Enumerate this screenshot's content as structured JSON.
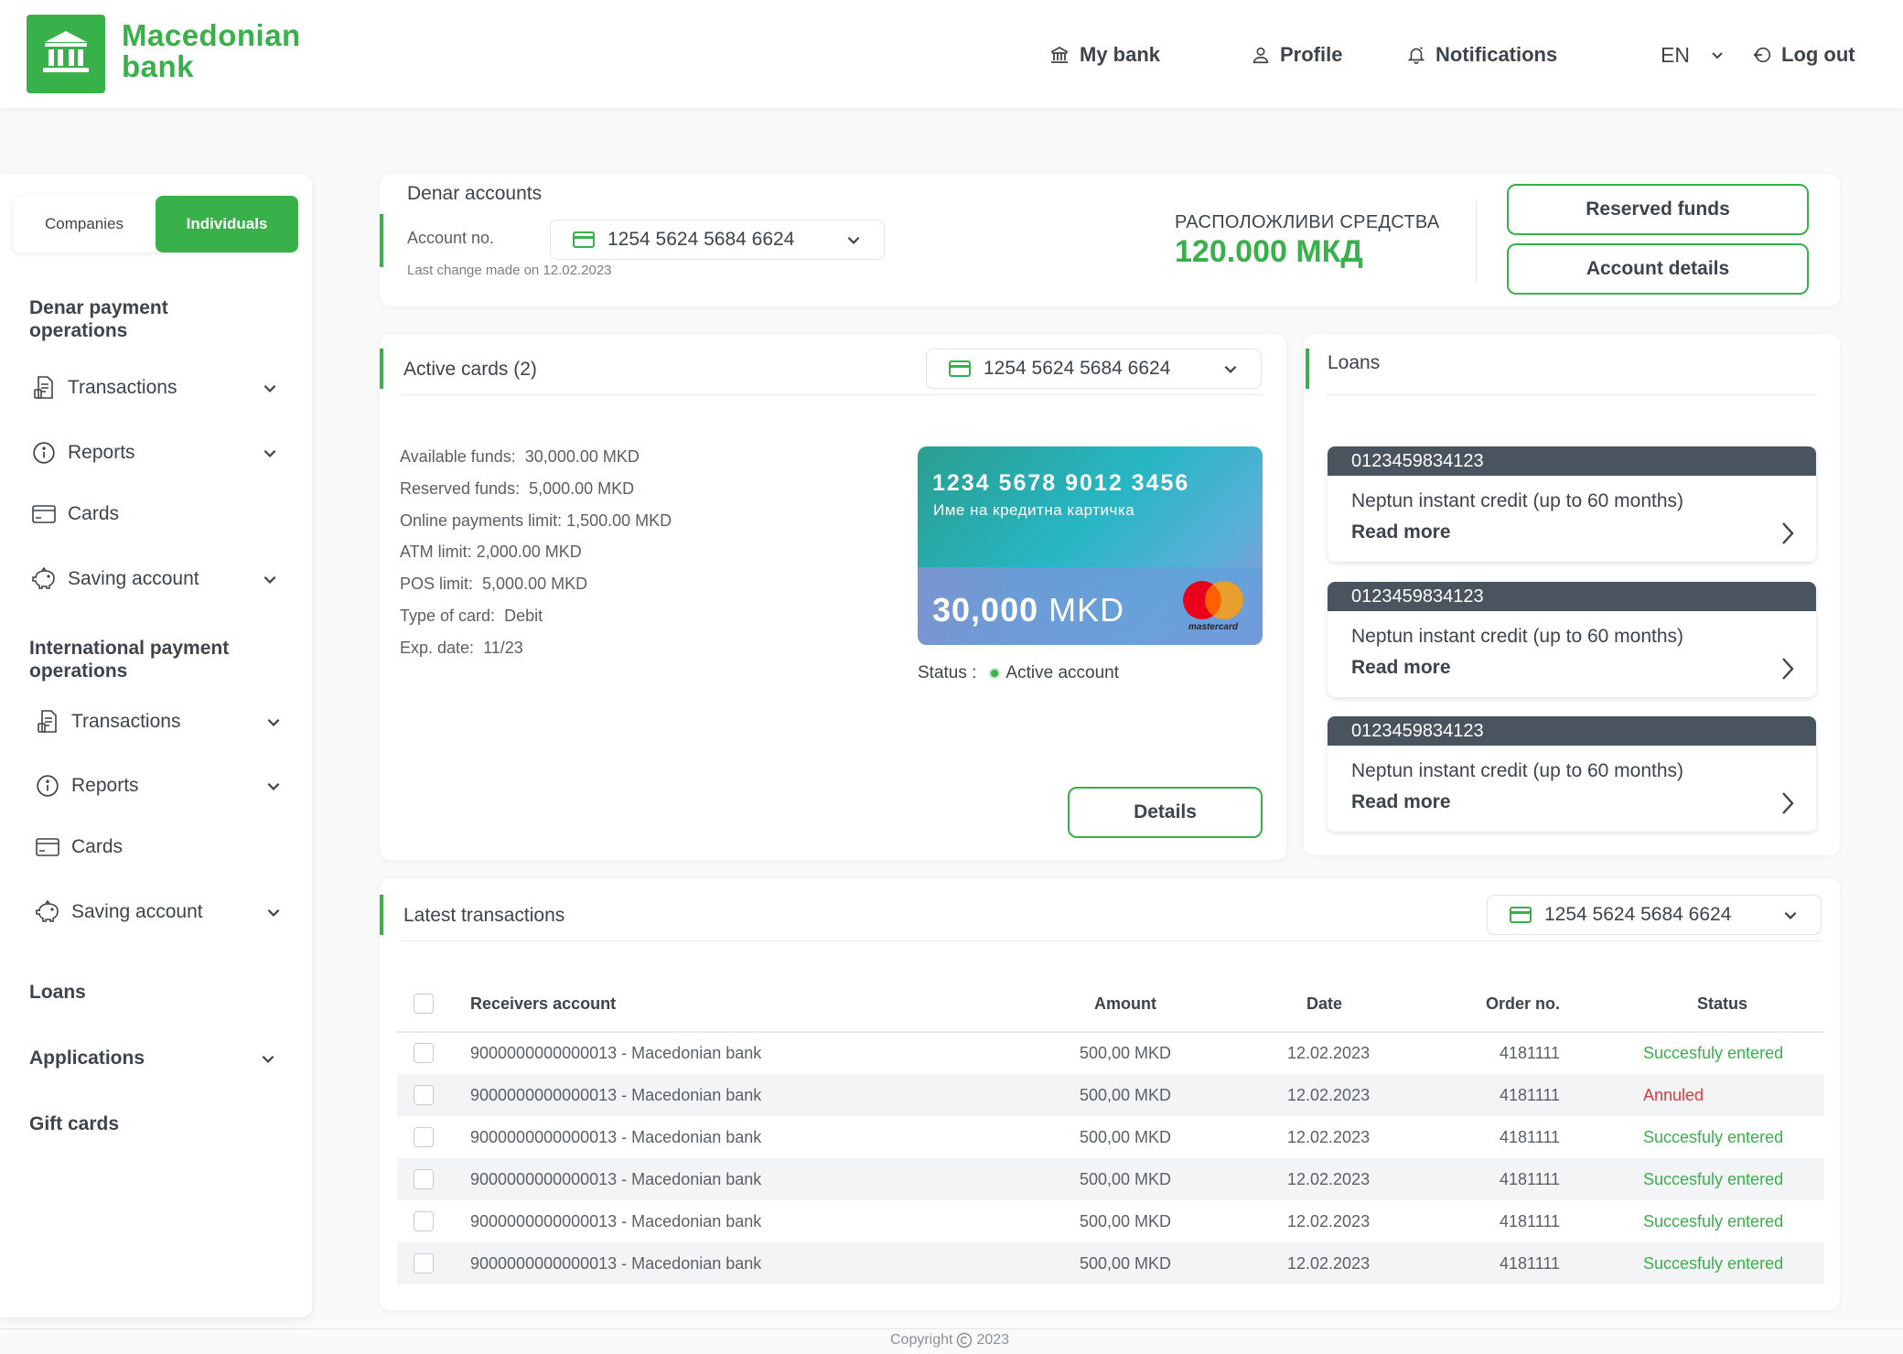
{
  "brand": {
    "line1": "Macedonian",
    "line2": "bank",
    "color": "#38b14a"
  },
  "nav": {
    "my_bank": "My bank",
    "profile": "Profile",
    "notifications": "Notifications",
    "language": "EN",
    "logout": "Log out"
  },
  "sidebar": {
    "tabs": {
      "companies": "Companies",
      "individuals": "Individuals",
      "active": "Individuals"
    },
    "denar_section": "Denar payment operations",
    "denar_items": [
      {
        "label": "Transactions",
        "icon": "document-icon"
      },
      {
        "label": "Reports",
        "icon": "info-icon"
      },
      {
        "label": "Cards",
        "icon": "card-icon"
      },
      {
        "label": "Saving account",
        "icon": "piggy-bank-icon"
      }
    ],
    "intl_section": "International payment operations",
    "intl_items": [
      {
        "label": "Transactions",
        "icon": "document-icon"
      },
      {
        "label": "Reports",
        "icon": "info-icon"
      },
      {
        "label": "Cards",
        "icon": "card-icon"
      },
      {
        "label": "Saving account",
        "icon": "piggy-bank-icon"
      }
    ],
    "loans": "Loans",
    "applications": "Applications",
    "gift_cards": "Gift cards"
  },
  "denar_accounts": {
    "title": "Denar accounts",
    "account_label": "Account no.",
    "account_number": "1254 5624 5684 6624",
    "last_change": "Last change made on 12.02.2023",
    "available_label": "РАСПОЛОЖЛИВИ СРЕДСТВА",
    "available_amount": "120.000 МКД",
    "reserved_button": "Reserved funds",
    "details_button": "Account details"
  },
  "active_cards": {
    "title": "Active cards (2)",
    "selected_account": "1254 5624 5684 6624",
    "info": [
      {
        "label": "Available funds:",
        "value": "30,000.00 MKD"
      },
      {
        "label": "Reserved funds:",
        "value": "5,000.00 MKD"
      },
      {
        "label": "Online payments limit:",
        "value": "1,500.00 MKD"
      },
      {
        "label": "ATM limit:",
        "value": "2,000.00 MKD"
      },
      {
        "label": "POS limit:",
        "value": "5,000.00 MKD"
      },
      {
        "label": "Type of card:",
        "value": "Debit"
      },
      {
        "label": "Exp. date:",
        "value": "11/23"
      }
    ],
    "card": {
      "number": "1234 5678 9012 3456",
      "name": "Име на кредитна картичка",
      "balance_value": "30,000",
      "balance_currency": "MKD",
      "brand": "mastercard"
    },
    "status_label": "Status :",
    "status_value": "Active account",
    "details_button": "Details"
  },
  "loans": {
    "title": "Loans",
    "items": [
      {
        "number": "0123459834123",
        "name": "Neptun instant credit (up to 60 months)",
        "link": "Read more"
      },
      {
        "number": "0123459834123",
        "name": "Neptun instant credit (up to 60 months)",
        "link": "Read more"
      },
      {
        "number": "0123459834123",
        "name": "Neptun instant credit (up to 60 months)",
        "link": "Read more"
      }
    ]
  },
  "transactions": {
    "title": "Latest transactions",
    "selected_account": "1254 5624 5684 6624",
    "columns": [
      "Receivers account",
      "Amount",
      "Date",
      "Order no.",
      "Status"
    ],
    "rows": [
      {
        "account": "9000000000000013 - Macedonian bank",
        "amount": "500,00 MKD",
        "date": "12.02.2023",
        "order": "4181111",
        "status": "Succesfuly entered",
        "status_color": "#38b14a"
      },
      {
        "account": "9000000000000013 - Macedonian bank",
        "amount": "500,00 MKD",
        "date": "12.02.2023",
        "order": "4181111",
        "status": "Annuled",
        "status_color": "#e03a3a"
      },
      {
        "account": "9000000000000013 - Macedonian bank",
        "amount": "500,00 MKD",
        "date": "12.02.2023",
        "order": "4181111",
        "status": "Succesfuly entered",
        "status_color": "#38b14a"
      },
      {
        "account": "9000000000000013 - Macedonian bank",
        "amount": "500,00 MKD",
        "date": "12.02.2023",
        "order": "4181111",
        "status": "Succesfuly entered",
        "status_color": "#38b14a"
      },
      {
        "account": "9000000000000013 - Macedonian bank",
        "amount": "500,00 MKD",
        "date": "12.02.2023",
        "order": "4181111",
        "status": "Succesfuly entered",
        "status_color": "#38b14a"
      },
      {
        "account": "9000000000000013 - Macedonian bank",
        "amount": "500,00 MKD",
        "date": "12.02.2023",
        "order": "4181111",
        "status": "Succesfuly entered",
        "status_color": "#38b14a"
      }
    ]
  },
  "footer": {
    "copyright": "Copyright",
    "year": "2023"
  }
}
